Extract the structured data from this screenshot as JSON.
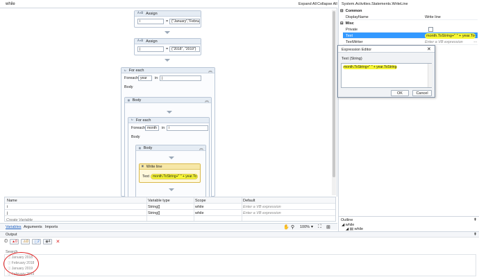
{
  "window": {
    "breadcrumb": "while",
    "expand_all": "Expand All",
    "collapse_all": "Collapse All"
  },
  "designer": {
    "assign1": {
      "title": "Assign",
      "to": "i",
      "value": "{\"January\",\"Februa"
    },
    "assign2": {
      "title": "Assign",
      "to": "j",
      "value": "{\"2018\", \"2019\"}"
    },
    "foreach_outer": {
      "title": "For each",
      "foreach_label": "Foreach",
      "item": "year",
      "in_label": "in",
      "source": "j",
      "body_label": "Body",
      "body_title": "Body"
    },
    "foreach_inner": {
      "title": "For each",
      "foreach_label": "Foreach",
      "item": "month",
      "in_label": "in",
      "source": "i",
      "body_label": "Body",
      "body_title": "Body"
    },
    "writeline": {
      "title": "Write line",
      "text_label": "Text",
      "text_value": "month.ToString+\" \" + year.To"
    },
    "assign_equals": "="
  },
  "variables": {
    "headers": [
      "Name",
      "Variable type",
      "Scope",
      "Default"
    ],
    "rows": [
      {
        "name": "i",
        "type": "String[]",
        "scope": "while",
        "default": "Enter a VB expression"
      },
      {
        "name": "j",
        "type": "String[]",
        "scope": "while",
        "default": "Enter a VB expression"
      }
    ],
    "create_variable": "Create Variable"
  },
  "bottom_tabs": {
    "variables": "Variables",
    "arguments": "Arguments",
    "imports": "Imports",
    "zoom": "100%"
  },
  "output": {
    "title": "Output",
    "counts": {
      "errors": "0",
      "warnings": "0",
      "info": "2",
      "trace": "4"
    },
    "search_placeholder": "Search",
    "messages": [
      "January 2018",
      "February 2018",
      "January 2019",
      "February 2019"
    ]
  },
  "properties": {
    "activity_type": "System.Activities.Statements.WriteLine",
    "common_section": "Common",
    "misc_section": "Misc",
    "rows": {
      "display_name": {
        "name": "DisplayName",
        "value": "Write line"
      },
      "private": {
        "name": "Private"
      },
      "text": {
        "name": "Text",
        "value": "month.ToString+\" \" + year.To"
      },
      "text_writer": {
        "name": "TextWriter",
        "value": "Enter a VB expression"
      }
    }
  },
  "expression_editor": {
    "title": "Expression Editor",
    "type_label": "Text (String)",
    "expression": "month.ToString+\" \" + year.ToString",
    "ok": "OK",
    "cancel": "Cancel"
  },
  "outline": {
    "title": "Outline",
    "nodes": [
      "while",
      "while"
    ]
  },
  "colors": {
    "highlight": "#f7f735",
    "selection": "#3399ff",
    "error": "#e02020"
  }
}
